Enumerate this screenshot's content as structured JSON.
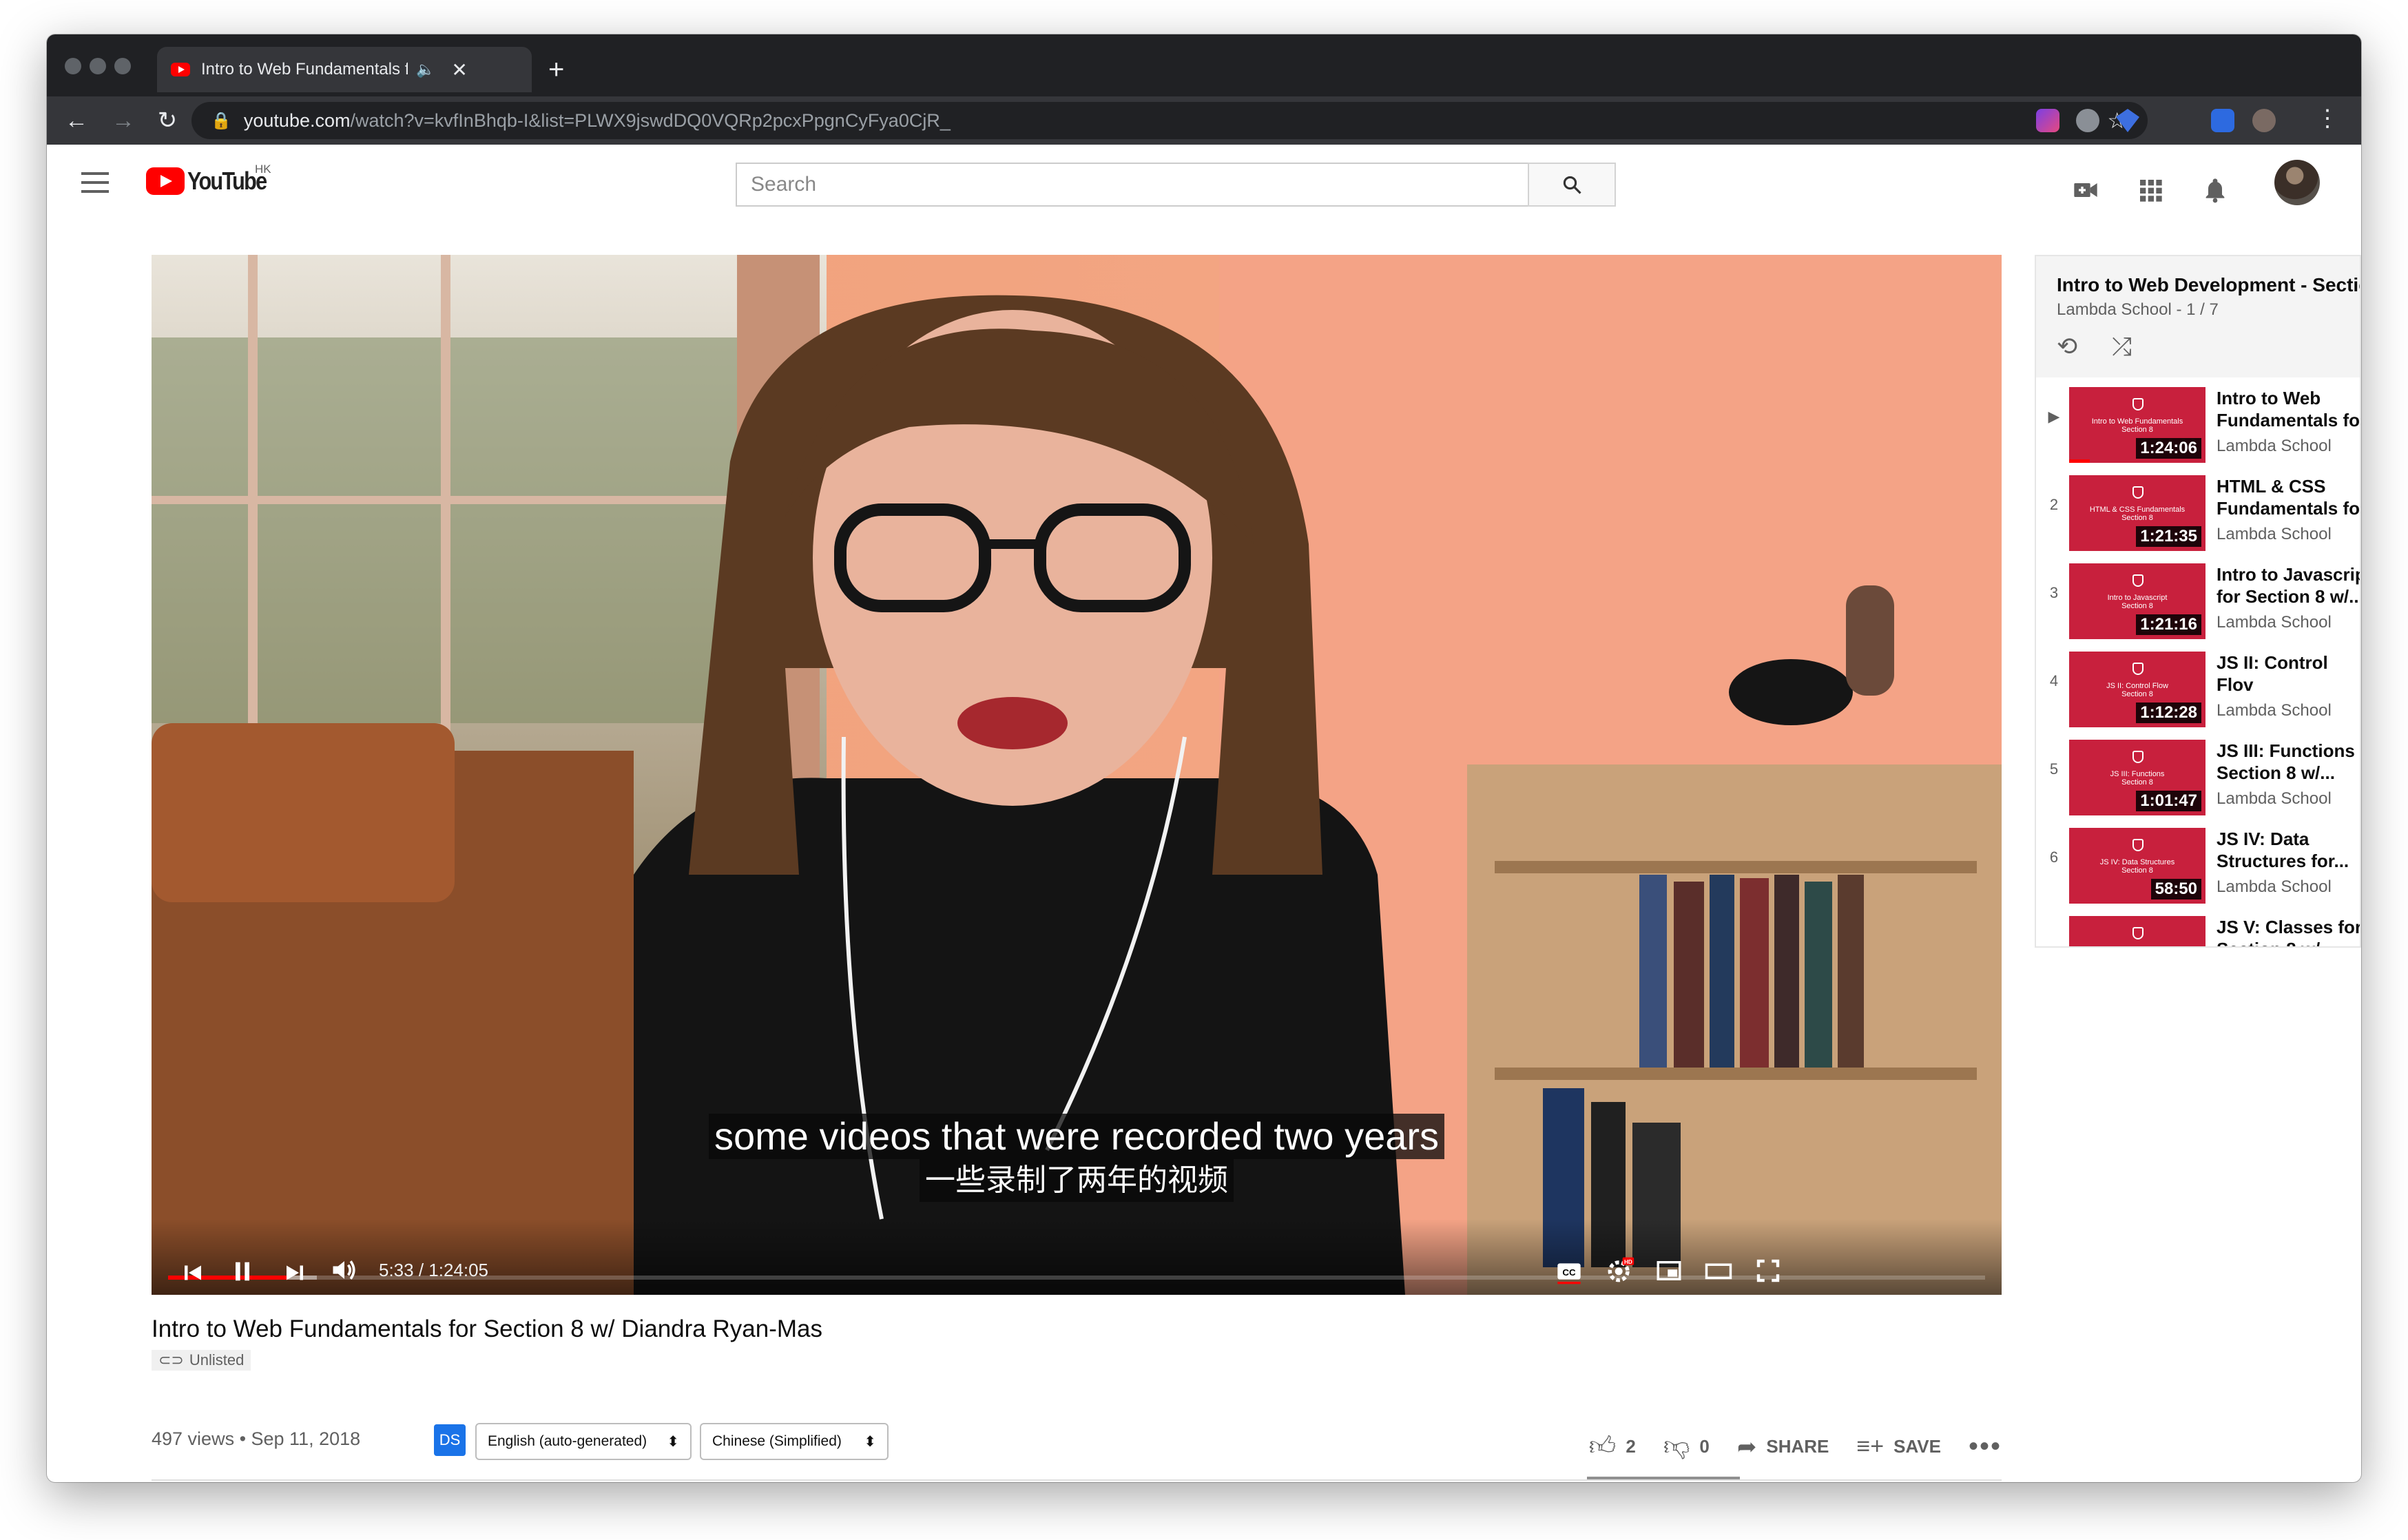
{
  "browser": {
    "tab_title": "Intro to Web Fundamentals f",
    "new_tab": "+",
    "url_host": "youtube.com",
    "url_path": "/watch?v=kvfInBhqb-I&list=PLWX9jswdDQ0VQRp2pcxPpgnCyFya0CjR_"
  },
  "header": {
    "logo_word": "YouTube",
    "region": "HK",
    "search_placeholder": "Search"
  },
  "player": {
    "caption_line1": "some videos that were recorded two years",
    "caption_line2": "一些录制了两年的视频",
    "time": "5:33 / 1:24:05",
    "progress_played_pct": 6.6,
    "progress_buffered_pct": 8.2
  },
  "playlist": {
    "title": "Intro to Web Development - Sectic",
    "subtitle": "Lambda School - 1 / 7",
    "items": [
      {
        "index": "▶",
        "thumb": "Intro to Web Fundamentals",
        "thumb_sub": "Section 8",
        "duration": "1:24:06",
        "title": "Intro to Web\nFundamentals fo",
        "channel": "Lambda School"
      },
      {
        "index": "2",
        "thumb": "HTML & CSS Fundamentals",
        "thumb_sub": "Section 8",
        "duration": "1:21:35",
        "title": "HTML & CSS\nFundamentals fo",
        "channel": "Lambda School"
      },
      {
        "index": "3",
        "thumb": "Intro to Javascript",
        "thumb_sub": "Section 8",
        "duration": "1:21:16",
        "title": "Intro to Javascrip\nfor Section 8 w/...",
        "channel": "Lambda School"
      },
      {
        "index": "4",
        "thumb": "JS II: Control Flow",
        "thumb_sub": "Section 8",
        "duration": "1:12:28",
        "title": "JS II: Control Flov\nfor Section 8 w/...",
        "channel": "Lambda School"
      },
      {
        "index": "5",
        "thumb": "JS III: Functions",
        "thumb_sub": "Section 8",
        "duration": "1:01:47",
        "title": "JS III: Functions f\nSection 8 w/...",
        "channel": "Lambda School"
      },
      {
        "index": "6",
        "thumb": "JS IV: Data Structures",
        "thumb_sub": "Section 8",
        "duration": "58:50",
        "title": "JS IV: Data\nStructures for...",
        "channel": "Lambda School"
      },
      {
        "index": "",
        "thumb": "",
        "thumb_sub": "",
        "duration": "",
        "title": "JS V: Classes for\nSection 8 w/...",
        "channel": ""
      }
    ]
  },
  "video": {
    "title": "Intro to Web Fundamentals for Section 8 w/ Diandra Ryan-Mas",
    "unlisted": "Unlisted",
    "views_date": "497 views • Sep 11, 2018",
    "ds": "DS",
    "lang1": "English (auto-generated)",
    "lang2": "Chinese (Simplified)",
    "likes": "2",
    "dislikes": "0",
    "share": "SHARE",
    "save": "SAVE"
  }
}
